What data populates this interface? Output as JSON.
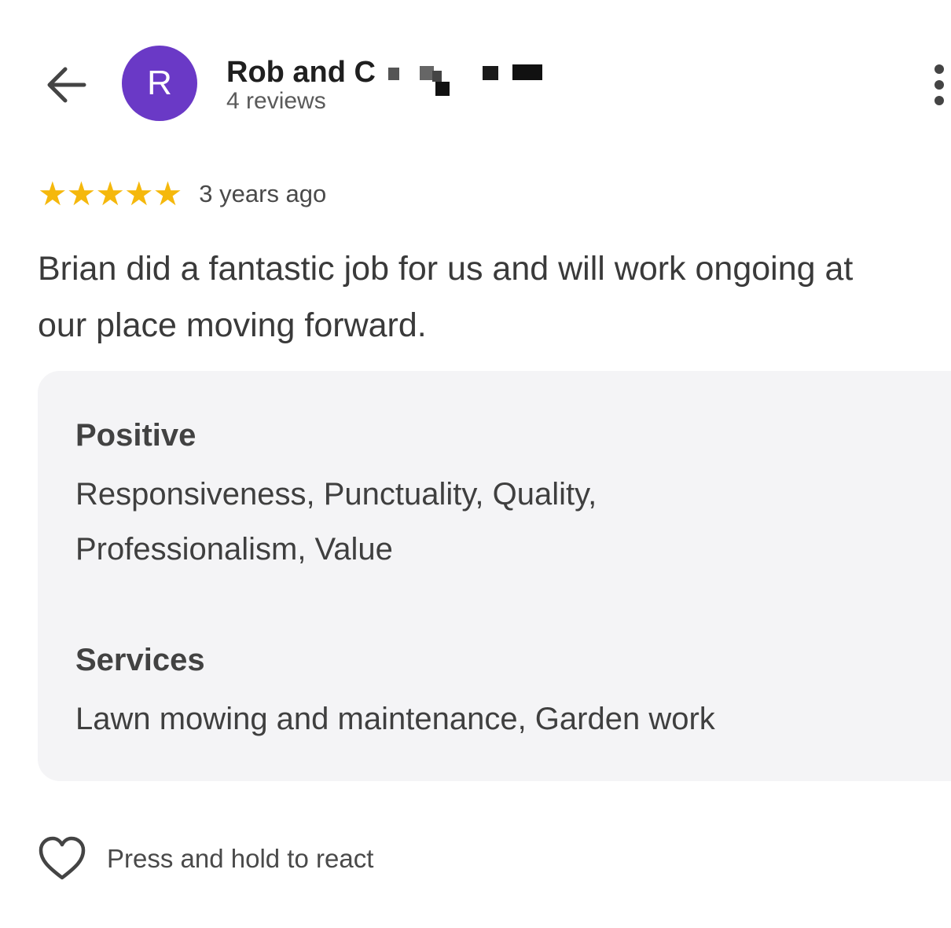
{
  "header": {
    "avatar_letter": "R",
    "avatar_color": "#6a39c6",
    "reviewer_name": "Rob and C",
    "review_count": "4 reviews",
    "back_icon": "arrow-left-icon",
    "more_icon": "more-vert-icon"
  },
  "review": {
    "rating": 5,
    "rating_max": 5,
    "star_color": "#f5b80c",
    "date": "3 years ago",
    "text_line1": "Brian did a fantastic job for us and will work ongoing at",
    "text_line2": "our place moving forward."
  },
  "attributes": {
    "positive_heading": "Positive",
    "positive_line1": "Responsiveness, Punctuality, Quality,",
    "positive_line2": "Professionalism, Value",
    "services_heading": "Services",
    "services_value": "Lawn mowing and maintenance, Garden work"
  },
  "reaction": {
    "icon": "heart-outline-icon",
    "label": "Press and hold to react"
  }
}
